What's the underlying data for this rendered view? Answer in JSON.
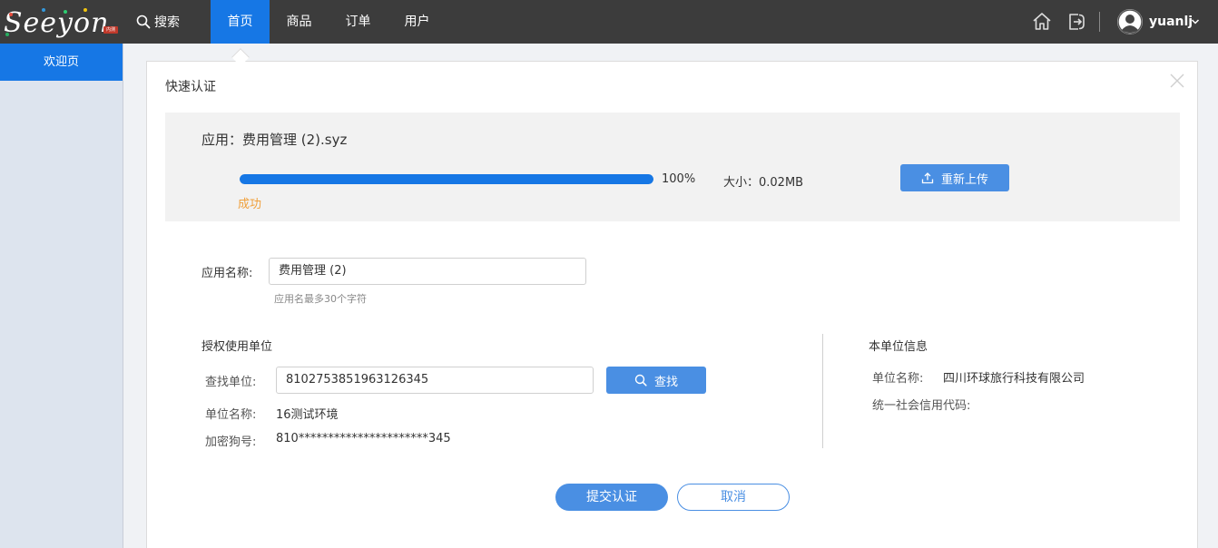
{
  "header": {
    "logo_text": "Seeyon",
    "logo_badge": "内测",
    "search_label": "搜索",
    "tabs": [
      {
        "label": "首页",
        "active": true
      },
      {
        "label": "商品",
        "active": false
      },
      {
        "label": "订单",
        "active": false
      },
      {
        "label": "用户",
        "active": false
      }
    ],
    "username": "yuanlj",
    "icons": [
      "home-icon",
      "logout-icon",
      "user-avatar-icon",
      "chevron-down-icon"
    ]
  },
  "sidebar": {
    "items": [
      {
        "label": "欢迎页",
        "active": true
      }
    ]
  },
  "dialog": {
    "title": "快速认证",
    "upload": {
      "app_line": "应用：费用管理 (2).syz",
      "progress": 100,
      "progress_text": "100%",
      "size_text": "大小：0.02MB",
      "status": "成功",
      "reupload_label": "重新上传"
    },
    "app_name": {
      "label": "应用名称:",
      "value": "费用管理 (2)",
      "hint": "应用名最多30个字符"
    },
    "auth_unit": {
      "title": "授权使用单位",
      "find_label": "查找单位:",
      "find_value": "8102753851963126345",
      "find_button": "查找",
      "unit_name_label": "单位名称:",
      "unit_name_value": "16测试环境",
      "dongle_label": "加密狗号:",
      "dongle_value": "810**********************345"
    },
    "own_unit": {
      "title": "本单位信息",
      "unit_name_label": "单位名称:",
      "unit_name_value": "四川环球旅行科技有限公司",
      "credit_code_label": "统一社会信用代码:",
      "credit_code_value": ""
    },
    "buttons": {
      "submit": "提交认证",
      "cancel": "取消"
    }
  },
  "colors": {
    "topbar": "#3c3c3c",
    "primary": "#1677e5",
    "button": "#4a8fe3",
    "success_text": "#f0a03c"
  }
}
